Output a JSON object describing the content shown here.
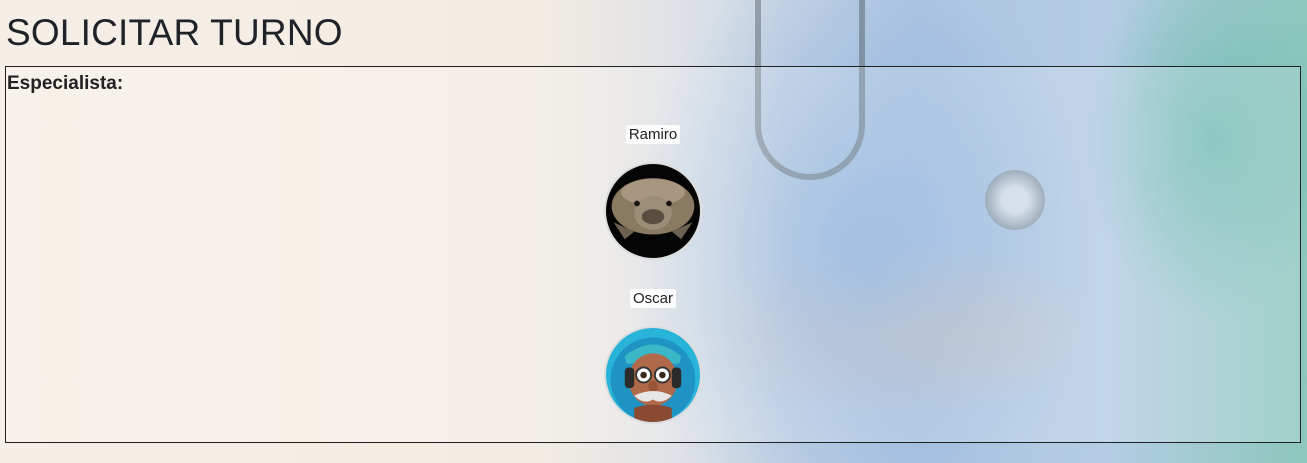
{
  "page": {
    "title": "SOLICITAR TURNO"
  },
  "panel": {
    "label": "Especialista:"
  },
  "specialists": [
    {
      "name": "Ramiro",
      "avatar_icon": "capybara-avatar-icon"
    },
    {
      "name": "Oscar",
      "avatar_icon": "cartoon-man-avatar-icon"
    }
  ]
}
